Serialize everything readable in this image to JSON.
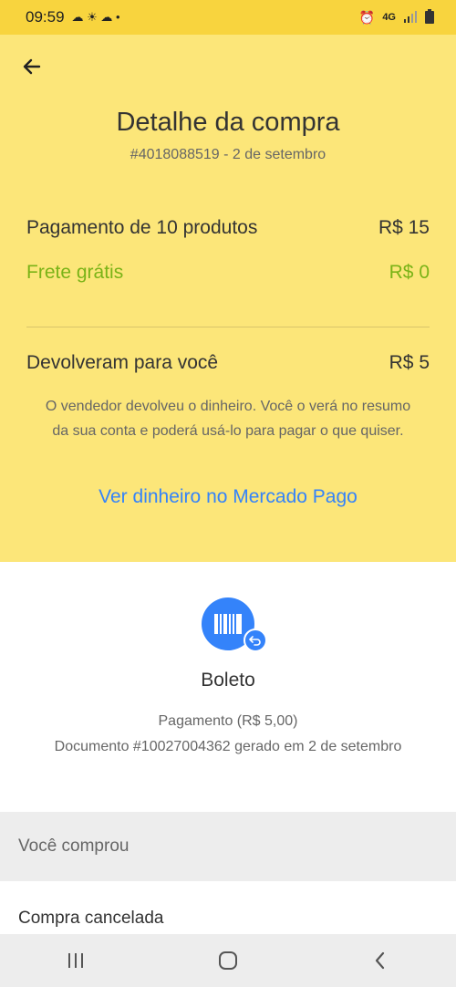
{
  "status_bar": {
    "time": "09:59",
    "network": "4G"
  },
  "header": {
    "back_icon": "arrow-left-icon",
    "title": "Detalhe da compra",
    "subtitle": "#4018088519 - 2 de setembro"
  },
  "summary": {
    "products_label": "Pagamento de 10 produtos",
    "products_value": "R$ 15",
    "shipping_label": "Frete grátis",
    "shipping_value": "R$ 0",
    "refund_label": "Devolveram para você",
    "refund_value": "R$ 5",
    "refund_note": "O vendedor devolveu o dinheiro. Você o verá no resumo da sua conta e poderá usá-lo para pagar o que quiser.",
    "mp_link": "Ver dinheiro no Mercado Pago"
  },
  "payment": {
    "icon": "barcode-icon",
    "badge_icon": "refund-arrow-icon",
    "method": "Boleto",
    "line1": "Pagamento (R$ 5,00)",
    "line2": "Documento #10027004362 gerado em 2 de setembro"
  },
  "purchase_section": {
    "header": "Você comprou",
    "status": "Compra cancelada"
  },
  "colors": {
    "yellow": "#fce679",
    "status_yellow": "#f8d43e",
    "accent_blue": "#3483fa",
    "green": "#7ab317"
  }
}
